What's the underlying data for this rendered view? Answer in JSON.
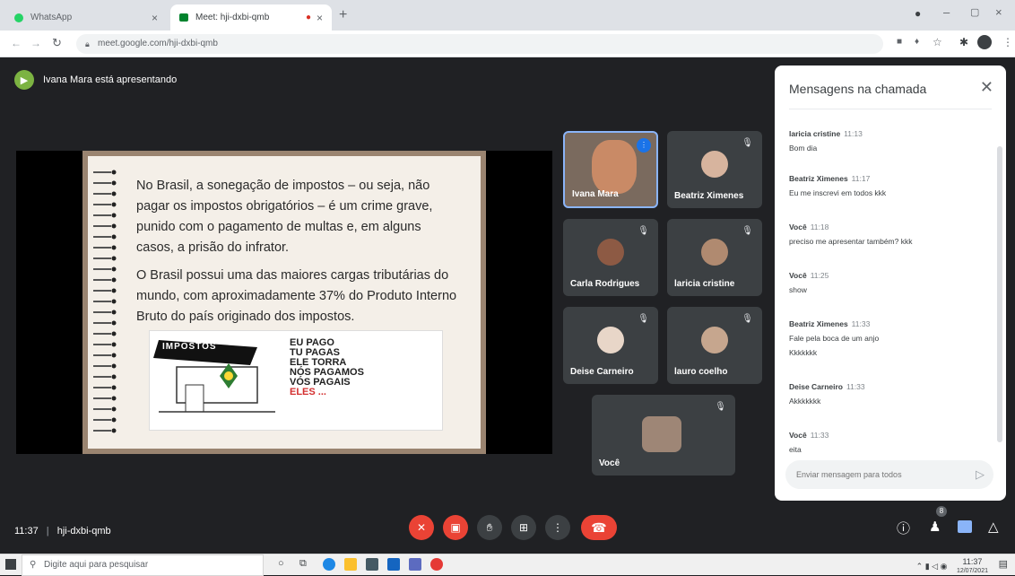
{
  "browser": {
    "tabs": [
      {
        "label": "WhatsApp",
        "icon": "whatsapp-icon",
        "active": false
      },
      {
        "label": "Meet: hji-dxbi-qmb",
        "icon": "meet-icon",
        "active": true
      }
    ],
    "url": "meet.google.com/hji-dxbi-qmb"
  },
  "meet": {
    "presenter_text": "Ivana Mara está apresentando",
    "slide": {
      "paragraph1": "No Brasil, a sonegação de impostos – ou seja, não pagar os impostos obrigatórios – é um crime grave, punido com o pagamento de multas e, em alguns casos, a prisão do infrator.",
      "paragraph2": "O Brasil possui uma das maiores cargas tributárias do mundo, com aproximadamente 37% do Produto Interno Bruto do país originado dos impostos.",
      "cartoon_sign": "IMPOSTOS",
      "cartoon_lines": [
        "EU PAGO",
        "TU PAGAS",
        "ELE TORRA",
        "NÓS PAGAMOS",
        "VÓS PAGAIS",
        "ELES ..."
      ]
    },
    "participants": [
      {
        "name": "Ivana Mara",
        "speaking": true
      },
      {
        "name": "Beatriz Ximenes"
      },
      {
        "name": "Carla Rodrigues"
      },
      {
        "name": "laricia cristine"
      },
      {
        "name": "Deise Carneiro"
      },
      {
        "name": "lauro coelho"
      },
      {
        "name": "Você"
      }
    ],
    "meeting_time": "11:37",
    "meeting_code": "hji-dxbi-qmb",
    "people_count": "8"
  },
  "chat": {
    "title": "Mensagens na chamada",
    "messages": [
      {
        "sender": "laricia cristine",
        "time": "11:13",
        "text": "Bom dia"
      },
      {
        "sender": "Beatriz Ximenes",
        "time": "11:17",
        "text": "Eu me inscrevi em todos kkk"
      },
      {
        "sender": "Você",
        "time": "11:18",
        "text": "preciso me apresentar também? kkk"
      },
      {
        "sender": "Você",
        "time": "11:25",
        "text": "show"
      },
      {
        "sender": "Beatriz Ximenes",
        "time": "11:33",
        "text": "Fale pela boca de um anjo",
        "text2": "Kkkkkkk"
      },
      {
        "sender": "Deise Carneiro",
        "time": "11:33",
        "text": "Akkkkkkk"
      },
      {
        "sender": "Você",
        "time": "11:33",
        "text": "eita"
      }
    ],
    "input_placeholder": "Enviar mensagem para todos"
  },
  "taskbar": {
    "search_placeholder": "Digite aqui para pesquisar",
    "time": "11:37",
    "date": "12/07/2021"
  },
  "colors": {
    "meet_bg": "#202124",
    "tile_bg": "#3c4043",
    "danger": "#ea4335",
    "accent": "#1a73e8"
  }
}
